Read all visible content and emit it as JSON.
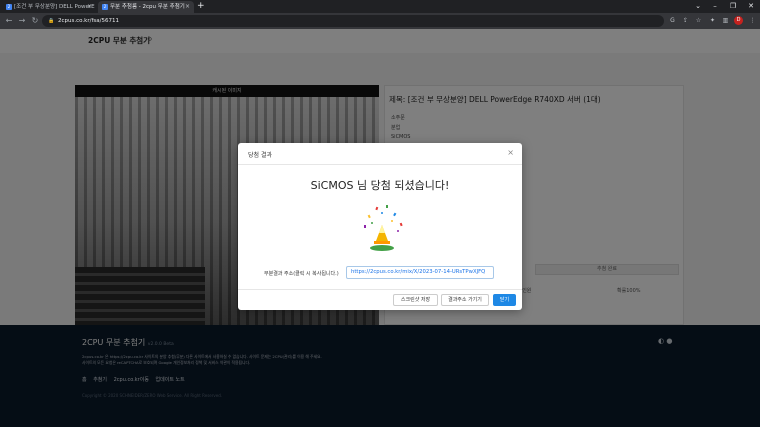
{
  "browser": {
    "tabs": [
      {
        "title": "[조건 부 무상분양] DELL PowerE"
      },
      {
        "title": "무분 추첨룸 - 2cpu 무분 추첨기"
      }
    ],
    "new_tab_label": "+",
    "url": "2cpus.co.kr/fsa/56711"
  },
  "site": {
    "brand": "2CPU 무분 추첨기",
    "photo_header": "캐시된 이미지",
    "post_title": "제목: [조건 부 무상분양] DELL PowerEdge R740XD 서버 (1대)",
    "info_lines": [
      "소주문",
      "분업",
      "SiCMOS"
    ],
    "info_button_right": "추첨 완료",
    "info_stat_left": "무분인원",
    "info_stat_right": "확률100%"
  },
  "footer": {
    "title": "2CPU 무분 추첨기",
    "version": "v2.0.0 Beta",
    "desc_1": "2cpus.co.kr 은 https://2cpu.co.kr 사이트의 분양 추첨(무분) 다른 사이트에서 사용하실 수 없습니다. 사이트 문제는 2CPU(관리)를 이용 해 주세요.",
    "desc_2": "사이트의 모든 요청은 reCAPTCHA로 보호되며 Google 개인정보처리 정책 및 서비스 약관이 적용됩니다.",
    "links": [
      "홈",
      "추첨기",
      "2cpu.co.kr이동",
      "업데이트 노트"
    ],
    "copyright": "Copyright © 2020 SCHNEIDER/ZERO Web Service. All Right Reserved."
  },
  "modal": {
    "title": "당첨 결과",
    "close": "×",
    "message": "SiCMOS 님 당첨 되셨습니다!",
    "address_label": "무분결과 주소(클릭 시 복사됩니다.)",
    "address_value": "https://2cpus.co.kr/mix/X/2023-07-14-URsTPwXJFQ",
    "buttons": {
      "screenshot": "스크린샷 저장",
      "goto": "결과주소 가기기",
      "close": "닫기"
    }
  },
  "colors": {
    "primary": "#1e88e5",
    "footer_bg": "#0b1a2b",
    "overlay": "rgba(0,0,0,0.5)"
  }
}
